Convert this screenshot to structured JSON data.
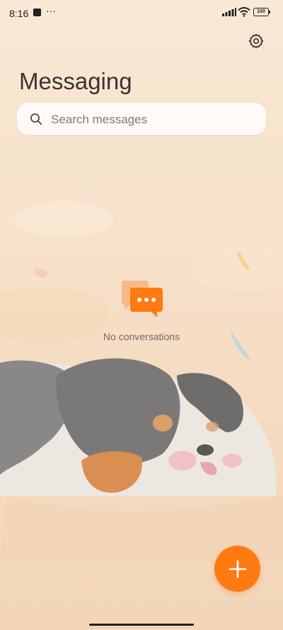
{
  "status": {
    "time": "8:16",
    "notification_more": "···",
    "battery": "100",
    "icons": [
      "notification-icon",
      "signal-icon",
      "wifi-icon",
      "battery-icon"
    ]
  },
  "header": {
    "title": "Messaging",
    "settings_icon": "gear-icon"
  },
  "search": {
    "placeholder": "Search messages",
    "icon": "search-icon"
  },
  "empty_state": {
    "icon": "chat-bubbles-icon",
    "text": "No conversations"
  },
  "fab": {
    "icon": "plus-icon"
  },
  "colors": {
    "accent": "#ff7a10",
    "background": "#f7e2cb",
    "search_bg": "#fffaf6",
    "title": "#3a3430"
  }
}
